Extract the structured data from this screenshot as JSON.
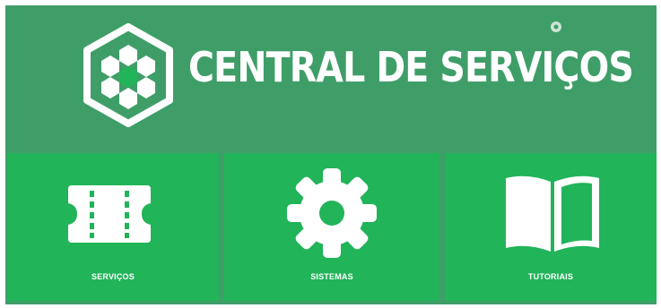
{
  "header": {
    "title": "CENTRAL DE SERVIÇOS",
    "logo_icon": "hexagon-honeycomb-logo",
    "settings_icon": "gear-small-icon"
  },
  "tiles": [
    {
      "label": "SERVIÇOS",
      "icon": "ticket-film-icon"
    },
    {
      "label": "SISTEMAS",
      "icon": "gear-icon"
    },
    {
      "label": "TUTORIAIS",
      "icon": "open-book-icon"
    }
  ],
  "colors": {
    "header_bg": "#3f9e68",
    "tile_bg": "#21b459",
    "accent": "#ffffff"
  }
}
